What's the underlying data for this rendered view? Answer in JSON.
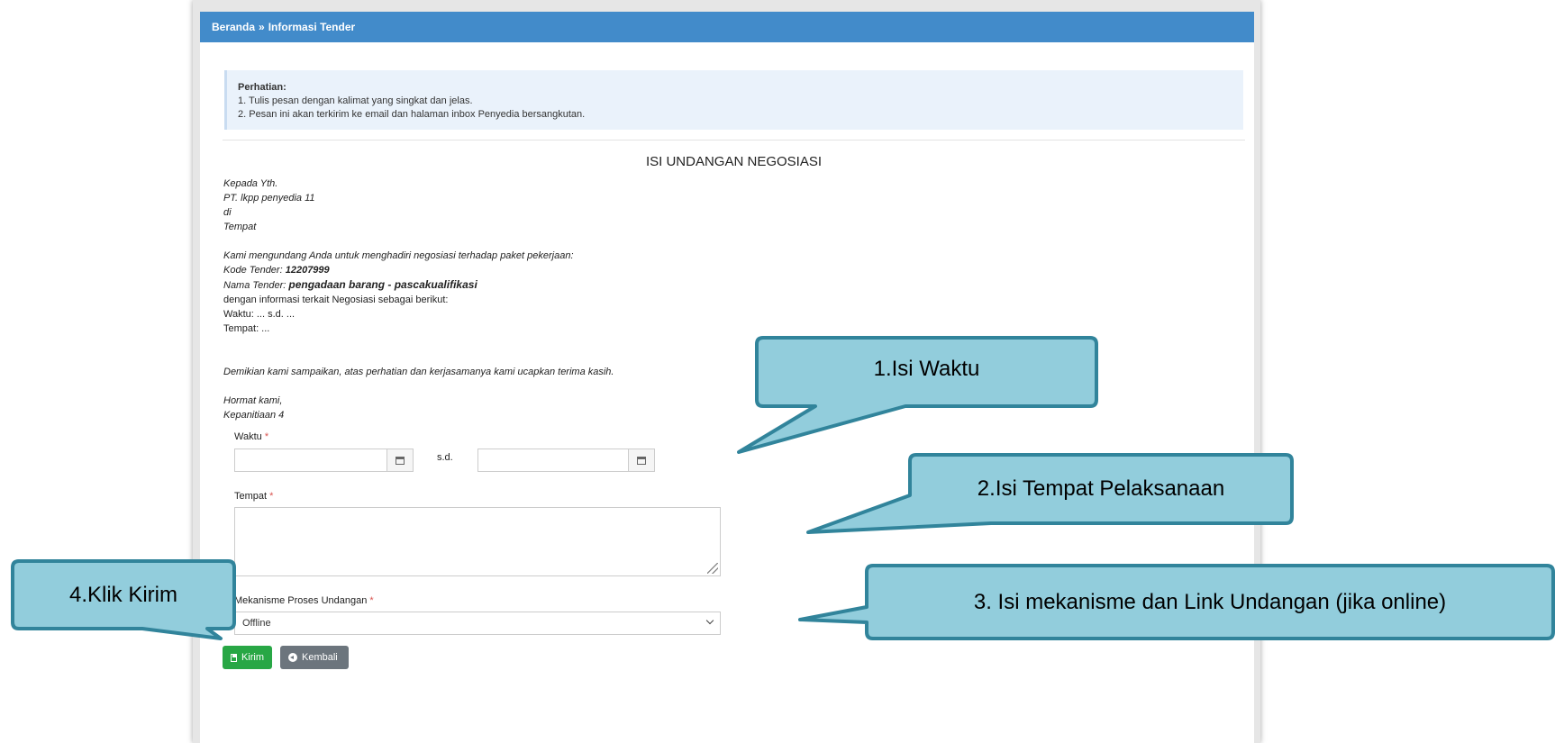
{
  "breadcrumb": {
    "home": "Beranda",
    "separator": "»",
    "current": "Informasi Tender"
  },
  "notice": {
    "title": "Perhatian:",
    "lines": [
      "1. Tulis pesan dengan kalimat yang singkat dan jelas.",
      "2. Pesan ini akan terkirim ke email dan halaman inbox Penyedia bersangkutan."
    ]
  },
  "document": {
    "title": "ISI UNDANGAN NEGOSIASI",
    "to": [
      "Kepada Yth.",
      "PT. lkpp penyedia 11",
      "di",
      "Tempat"
    ],
    "intro": "Kami mengundang Anda untuk menghadiri negosiasi terhadap paket pekerjaan:",
    "kode_label": "Kode Tender:",
    "kode_value": "12207999",
    "nama_label": "Nama Tender:",
    "nama_value": "pengadaan barang - pascakualifikasi",
    "info_line": "dengan informasi terkait Negosiasi sebagai berikut:",
    "waktu_line": "Waktu: ... s.d. ...",
    "tempat_line": "Tempat: ...",
    "closing": "Demikian kami sampaikan, atas perhatian dan kerjasamanya kami ucapkan terima kasih.",
    "regards": "Hormat kami,",
    "sender": "Kepanitiaan 4"
  },
  "form": {
    "waktu_label": "Waktu",
    "required_mark": "*",
    "sd_label": "s.d.",
    "tempat_label": "Tempat",
    "mekanisme_label": "Mekanisme Proses Undangan",
    "mekanisme_value": "Offline"
  },
  "buttons": {
    "kirim": "Kirim",
    "kembali": "Kembali"
  },
  "callouts": {
    "c1": "1.Isi Waktu",
    "c2": "2.Isi Tempat Pelaksanaan",
    "c3": "3. Isi mekanisme dan Link Undangan (jika online)",
    "c4": "4.Klik Kirim"
  },
  "colors": {
    "header": "#428bca",
    "callout_fill": "#92cddc",
    "callout_border": "#31849b",
    "kirim": "#28a745",
    "kembali": "#6c757d"
  }
}
